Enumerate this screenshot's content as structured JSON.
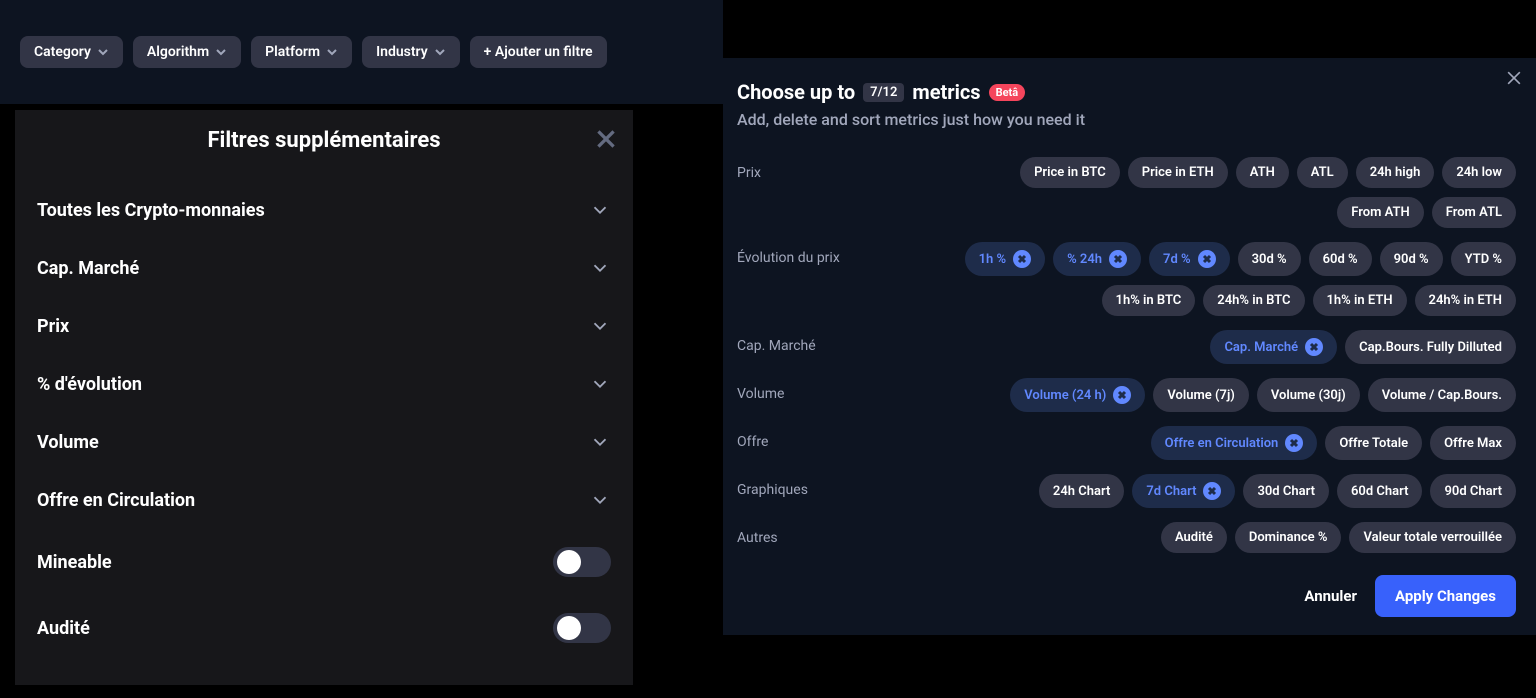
{
  "filter_bar": {
    "items": [
      "Category",
      "Algorithm",
      "Platform",
      "Industry"
    ],
    "add_filter": "+ Ajouter un filtre"
  },
  "filters_panel": {
    "title": "Filtres supplémentaires",
    "rows": [
      "Toutes les Crypto-monnaies",
      "Cap. Marché",
      "Prix",
      "% d'évolution",
      "Volume",
      "Offre en Circulation"
    ],
    "toggles": [
      "Mineable",
      "Audité"
    ]
  },
  "metrics": {
    "title_pre": "Choose up to",
    "count": "7/12",
    "title_post": "metrics",
    "beta": "Betâ",
    "sub": "Add, delete and sort metrics just how you need it",
    "sections": [
      {
        "name": "Prix",
        "chips": [
          {
            "label": "Price in BTC",
            "selected": false
          },
          {
            "label": "Price in ETH",
            "selected": false
          },
          {
            "label": "ATH",
            "selected": false
          },
          {
            "label": "ATL",
            "selected": false
          },
          {
            "label": "24h high",
            "selected": false
          },
          {
            "label": "24h low",
            "selected": false
          },
          {
            "label": "From ATH",
            "selected": false
          },
          {
            "label": "From ATL",
            "selected": false
          }
        ]
      },
      {
        "name": "Évolution du prix",
        "chips": [
          {
            "label": "1h %",
            "selected": true
          },
          {
            "label": "% 24h",
            "selected": true
          },
          {
            "label": "7d %",
            "selected": true
          },
          {
            "label": "30d %",
            "selected": false
          },
          {
            "label": "60d %",
            "selected": false
          },
          {
            "label": "90d %",
            "selected": false
          },
          {
            "label": "YTD %",
            "selected": false
          },
          {
            "label": "1h% in BTC",
            "selected": false
          },
          {
            "label": "24h% in BTC",
            "selected": false
          },
          {
            "label": "1h% in ETH",
            "selected": false
          },
          {
            "label": "24h% in ETH",
            "selected": false
          }
        ]
      },
      {
        "name": "Cap. Marché",
        "chips": [
          {
            "label": "Cap. Marché",
            "selected": true
          },
          {
            "label": "Cap.Bours. Fully Dilluted",
            "selected": false
          }
        ]
      },
      {
        "name": "Volume",
        "chips": [
          {
            "label": "Volume (24 h)",
            "selected": true
          },
          {
            "label": "Volume (7j)",
            "selected": false
          },
          {
            "label": "Volume (30j)",
            "selected": false
          },
          {
            "label": "Volume / Cap.Bours.",
            "selected": false
          }
        ]
      },
      {
        "name": "Offre",
        "chips": [
          {
            "label": "Offre en Circulation",
            "selected": true
          },
          {
            "label": "Offre Totale",
            "selected": false
          },
          {
            "label": "Offre Max",
            "selected": false
          }
        ]
      },
      {
        "name": "Graphiques",
        "chips": [
          {
            "label": "24h Chart",
            "selected": false
          },
          {
            "label": "7d Chart",
            "selected": true
          },
          {
            "label": "30d Chart",
            "selected": false
          },
          {
            "label": "60d Chart",
            "selected": false
          },
          {
            "label": "90d Chart",
            "selected": false
          }
        ]
      },
      {
        "name": "Autres",
        "chips": [
          {
            "label": "Audité",
            "selected": false
          },
          {
            "label": "Dominance %",
            "selected": false
          },
          {
            "label": "Valeur totale verrouillée",
            "selected": false
          }
        ]
      }
    ],
    "cancel": "Annuler",
    "apply": "Apply Changes"
  }
}
